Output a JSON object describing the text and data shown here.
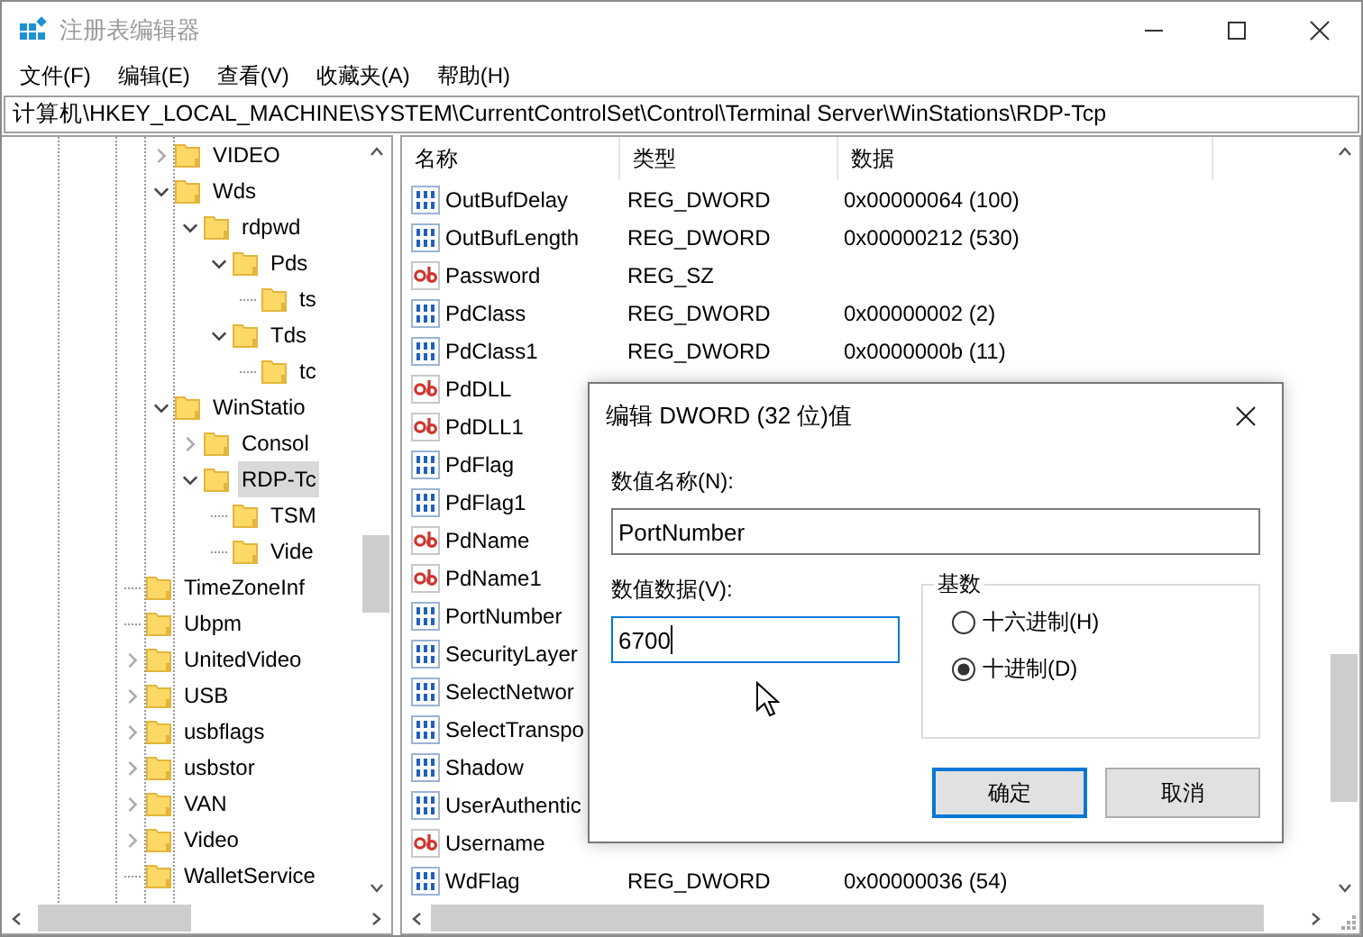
{
  "window": {
    "title": "注册表编辑器"
  },
  "menu": [
    "文件(F)",
    "编辑(E)",
    "查看(V)",
    "收藏夹(A)",
    "帮助(H)"
  ],
  "address": "计算机\\HKEY_LOCAL_MACHINE\\SYSTEM\\CurrentControlSet\\Control\\Terminal Server\\WinStations\\RDP-Tcp",
  "tree": {
    "items": [
      {
        "children": [
          {
            "label": "VIDEO",
            "kind": "branch",
            "expanded": false,
            "selected": false
          },
          {
            "label": "Wds",
            "kind": "branch",
            "expanded": true,
            "selected": false,
            "children": [
              {
                "label": "rdpwd",
                "kind": "branch",
                "expanded": true,
                "selected": false,
                "children": [
                  {
                    "label": "Pds",
                    "kind": "branch",
                    "expanded": true,
                    "selected": false,
                    "children": [
                      {
                        "label": "ts",
                        "kind": "leaf",
                        "selected": false
                      }
                    ]
                  },
                  {
                    "label": "Tds",
                    "kind": "branch",
                    "expanded": true,
                    "selected": false,
                    "children": [
                      {
                        "label": "tc",
                        "kind": "leaf",
                        "selected": false
                      }
                    ]
                  }
                ]
              }
            ]
          },
          {
            "label": "WinStatio",
            "kind": "branch",
            "expanded": true,
            "selected": false,
            "children": [
              {
                "label": "Consol",
                "kind": "branch",
                "expanded": false,
                "selected": false
              },
              {
                "label": "RDP-Tc",
                "kind": "branch",
                "expanded": true,
                "selected": true,
                "children": [
                  {
                    "label": "TSM",
                    "kind": "leaf",
                    "selected": false
                  },
                  {
                    "label": "Vide",
                    "kind": "leaf",
                    "selected": false
                  }
                ]
              }
            ]
          }
        ]
      },
      {
        "label": "TimeZoneInf",
        "kind": "leaf",
        "selected": false
      },
      {
        "label": "Ubpm",
        "kind": "leaf",
        "selected": false
      },
      {
        "label": "UnitedVideo",
        "kind": "branch",
        "expanded": false,
        "selected": false
      },
      {
        "label": "USB",
        "kind": "branch",
        "expanded": false,
        "selected": false
      },
      {
        "label": "usbflags",
        "kind": "branch",
        "expanded": false,
        "selected": false
      },
      {
        "label": "usbstor",
        "kind": "branch",
        "expanded": false,
        "selected": false
      },
      {
        "label": "VAN",
        "kind": "branch",
        "expanded": false,
        "selected": false
      },
      {
        "label": "Video",
        "kind": "branch",
        "expanded": false,
        "selected": false
      },
      {
        "label": "WalletService",
        "kind": "leaf",
        "selected": false
      }
    ]
  },
  "values": {
    "columns": [
      "名称",
      "类型",
      "数据"
    ],
    "rows": [
      {
        "kind": "dword",
        "name": "OutBufDelay",
        "type": "REG_DWORD",
        "data": "0x00000064 (100)"
      },
      {
        "kind": "dword",
        "name": "OutBufLength",
        "type": "REG_DWORD",
        "data": "0x00000212 (530)"
      },
      {
        "kind": "sz",
        "name": "Password",
        "type": "REG_SZ"
      },
      {
        "kind": "dword",
        "name": "PdClass",
        "type": "REG_DWORD",
        "data": "0x00000002 (2)"
      },
      {
        "kind": "dword",
        "name": "PdClass1",
        "type": "REG_DWORD",
        "data": "0x0000000b (11)"
      },
      {
        "kind": "sz",
        "name": "PdDLL"
      },
      {
        "kind": "sz",
        "name": "PdDLL1"
      },
      {
        "kind": "dword",
        "name": "PdFlag"
      },
      {
        "kind": "dword",
        "name": "PdFlag1"
      },
      {
        "kind": "sz",
        "name": "PdName"
      },
      {
        "kind": "sz",
        "name": "PdName1"
      },
      {
        "kind": "dword",
        "name": "PortNumber"
      },
      {
        "kind": "dword",
        "name": "SecurityLayer"
      },
      {
        "kind": "dword",
        "name": "SelectNetwor"
      },
      {
        "kind": "dword",
        "name": "SelectTranspo"
      },
      {
        "kind": "dword",
        "name": "Shadow"
      },
      {
        "kind": "dword",
        "name": "UserAuthentic"
      },
      {
        "kind": "sz",
        "name": "Username"
      },
      {
        "kind": "dword",
        "name": "WdFlag",
        "type": "REG_DWORD",
        "data": "0x00000036 (54)"
      }
    ]
  },
  "dialog": {
    "title": "编辑 DWORD (32 位)值",
    "name_label": "数值名称(N):",
    "name_value": "PortNumber",
    "data_label": "数值数据(V):",
    "data_value": "6700",
    "base": {
      "title": "基数",
      "options": [
        {
          "label": "十六进制(H)",
          "selected": false
        },
        {
          "label": "十进制(D)",
          "selected": true
        }
      ]
    },
    "buttons": [
      {
        "label": "确定",
        "default": true
      },
      {
        "label": "取消",
        "default": false
      }
    ]
  }
}
